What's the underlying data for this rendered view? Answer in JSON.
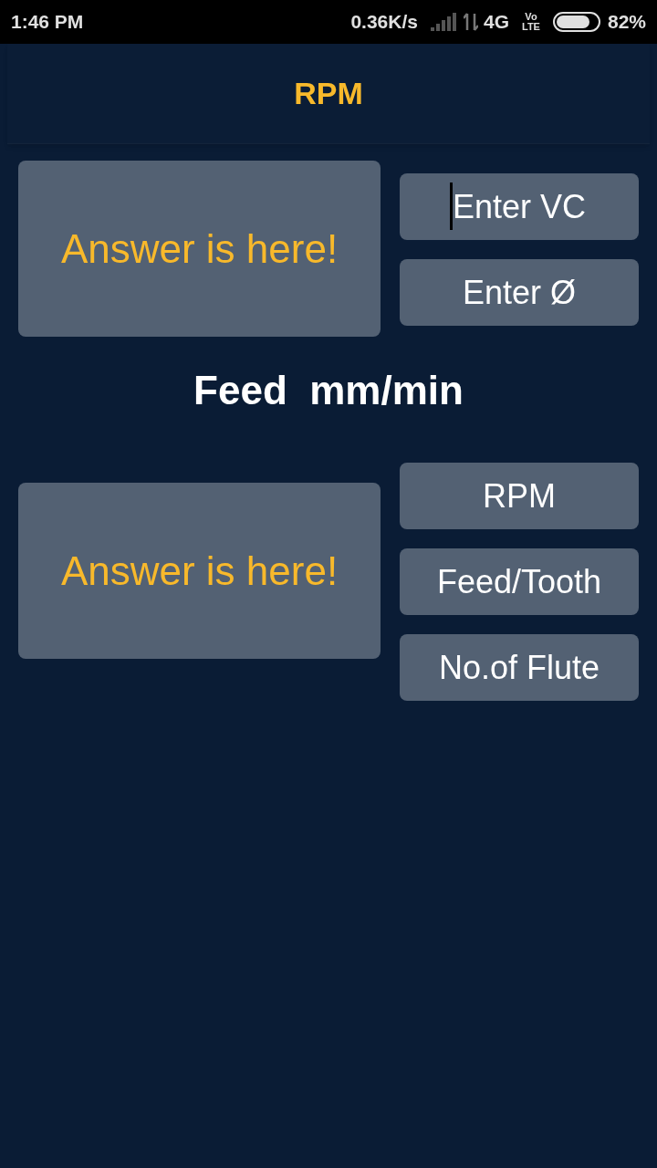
{
  "status_bar": {
    "time": "1:46 PM",
    "speed": "0.36K/s",
    "network": "4G",
    "volte_top": "Vo",
    "volte_bottom": "LTE",
    "battery": "82%"
  },
  "app_bar": {
    "title": "RPM"
  },
  "sections": [
    {
      "answer": "Answer is here!",
      "inputs": [
        {
          "placeholder": "Enter VC",
          "focused": true
        },
        {
          "placeholder": "Enter Ø",
          "focused": false
        }
      ]
    },
    {
      "title": "Feed  mm/min",
      "answer": "Answer is here!",
      "inputs": [
        {
          "placeholder": "RPM",
          "focused": false
        },
        {
          "placeholder": "Feed/Tooth",
          "focused": false
        },
        {
          "placeholder": "No.of Flute",
          "focused": false
        }
      ]
    }
  ]
}
